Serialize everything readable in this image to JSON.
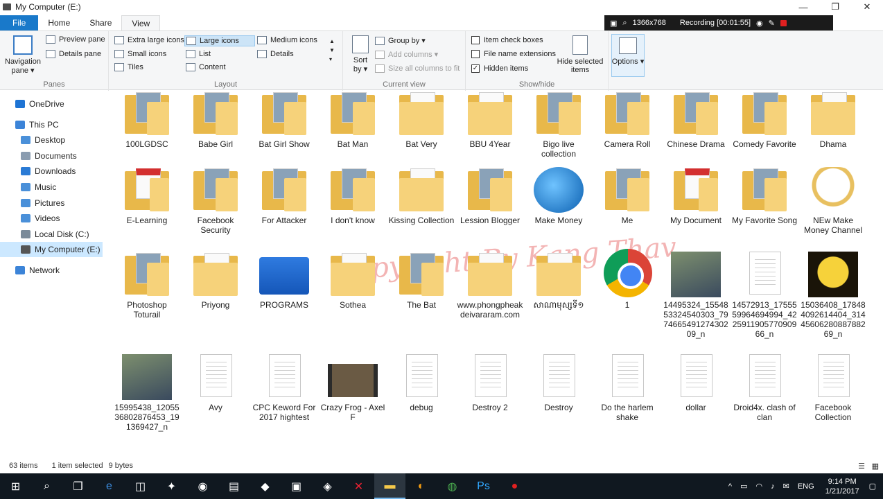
{
  "window": {
    "title": "My Computer (E:)",
    "minimize": "—",
    "maximize": "❐",
    "close": "✕"
  },
  "recording": {
    "resolution": "1366x768",
    "status": "Recording [00:01:55]"
  },
  "tabs": [
    "File",
    "Home",
    "Share",
    "View"
  ],
  "ribbon": {
    "panes": {
      "navigation_pane": "Navigation pane ▾",
      "preview_pane": "Preview pane",
      "details_pane": "Details pane",
      "label": "Panes"
    },
    "layout": {
      "extra_large": "Extra large icons",
      "large": "Large icons",
      "medium": "Medium icons",
      "small": "Small icons",
      "list": "List",
      "details": "Details",
      "tiles": "Tiles",
      "content": "Content",
      "label": "Layout"
    },
    "current_view": {
      "sort_by": "Sort by ▾",
      "group_by": "Group by ▾",
      "add_columns": "Add columns ▾",
      "size_columns": "Size all columns to fit",
      "label": "Current view"
    },
    "show_hide": {
      "item_check_boxes": "Item check boxes",
      "file_name_extensions": "File name extensions",
      "hidden_items": "Hidden items",
      "hide_selected": "Hide selected items",
      "label": "Show/hide"
    },
    "options": "Options ▾"
  },
  "nav": {
    "items": [
      {
        "label": "OneDrive",
        "color": "#1e74d4"
      },
      {
        "label": "This PC",
        "color": "#3c84d8"
      },
      {
        "label": "Desktop",
        "color": "#4a90d9"
      },
      {
        "label": "Documents",
        "color": "#8a9cb0"
      },
      {
        "label": "Downloads",
        "color": "#2a7bd5"
      },
      {
        "label": "Music",
        "color": "#4a90d9"
      },
      {
        "label": "Pictures",
        "color": "#4a90d9"
      },
      {
        "label": "Videos",
        "color": "#4a90d9"
      },
      {
        "label": "Local Disk (C:)",
        "color": "#7a8a99"
      },
      {
        "label": "My Computer (E:)",
        "color": "#555"
      },
      {
        "label": "Network",
        "color": "#3c84d8"
      }
    ]
  },
  "files": [
    {
      "name": "100LGDSC",
      "type": "folder-photo"
    },
    {
      "name": "Babe Girl",
      "type": "folder-photo"
    },
    {
      "name": "Bat Girl Show",
      "type": "folder-photo"
    },
    {
      "name": "Bat Man",
      "type": "folder-photo"
    },
    {
      "name": "Bat Very",
      "type": "folder"
    },
    {
      "name": "BBU 4Year",
      "type": "folder"
    },
    {
      "name": "Bigo live collection",
      "type": "folder-photo"
    },
    {
      "name": "Camera Roll",
      "type": "folder-photo"
    },
    {
      "name": "Chinese Drama",
      "type": "folder-photo"
    },
    {
      "name": "Comedy Favorite",
      "type": "folder-photo"
    },
    {
      "name": "Dhama",
      "type": "folder"
    },
    {
      "name": "E-Learning",
      "type": "folder-pdf"
    },
    {
      "name": "Facebook Security",
      "type": "folder-photo"
    },
    {
      "name": "For Attacker",
      "type": "folder-photo"
    },
    {
      "name": "I don't know",
      "type": "folder-photo"
    },
    {
      "name": "Kissing Collection",
      "type": "folder"
    },
    {
      "name": "Lession Blogger",
      "type": "folder-photo"
    },
    {
      "name": "Make Money",
      "type": "globe"
    },
    {
      "name": "Me",
      "type": "folder-photo"
    },
    {
      "name": "My Document",
      "type": "folder-pdf"
    },
    {
      "name": "My Favorite Song",
      "type": "folder-photo"
    },
    {
      "name": "NEw Make Money Channel",
      "type": "cat"
    },
    {
      "name": "Photoshop Toturail",
      "type": "folder-photo"
    },
    {
      "name": "Priyong",
      "type": "folder"
    },
    {
      "name": "PROGRAMS",
      "type": "app"
    },
    {
      "name": "Sothea",
      "type": "folder"
    },
    {
      "name": "The Bat",
      "type": "folder-photo"
    },
    {
      "name": "www.phongpheakdeivararam.com",
      "type": "folder"
    },
    {
      "name": "សាណាមុស្សទី១",
      "type": "folder"
    },
    {
      "name": "1",
      "type": "chrome"
    },
    {
      "name": "14495324_1554853324540303_797466549127430209_n",
      "type": "photo"
    },
    {
      "name": "14572913_1755559964694994_422591190577090966_n",
      "type": "doc"
    },
    {
      "name": "15036408_178484092614404_3144560628088788269_n",
      "type": "moon"
    },
    {
      "name": "15995438_1205536802876453_191369427_n",
      "type": "photo"
    },
    {
      "name": "Avy",
      "type": "doc"
    },
    {
      "name": "CPC Keword For 2017 hightest",
      "type": "doc"
    },
    {
      "name": "Crazy Frog - Axel F",
      "type": "video"
    },
    {
      "name": "debug",
      "type": "doc"
    },
    {
      "name": "Destroy 2",
      "type": "doc"
    },
    {
      "name": "Destroy",
      "type": "doc"
    },
    {
      "name": "Do the harlem shake",
      "type": "doc"
    },
    {
      "name": "dollar",
      "type": "doc"
    },
    {
      "name": "Droid4x. clash of clan",
      "type": "doc"
    },
    {
      "name": "Facebook Collection",
      "type": "doc"
    }
  ],
  "watermark": "Copyright By Kang Thav",
  "status": {
    "count": "63 items",
    "selected": "1 item selected",
    "size": "9 bytes"
  },
  "taskbar": {
    "time": "9:14 PM",
    "date": "1/21/2017",
    "lang": "ENG"
  }
}
